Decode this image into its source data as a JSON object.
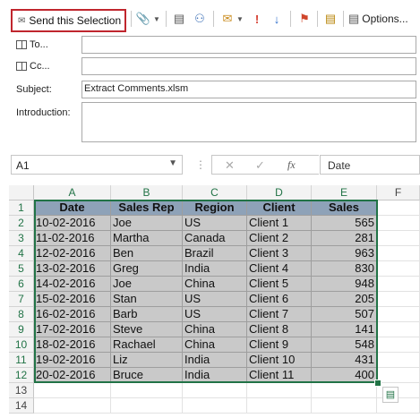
{
  "toolbar": {
    "send_selection_label": "Send this Selection",
    "options_label": "Options..."
  },
  "email": {
    "to_label": "To...",
    "cc_label": "Cc...",
    "subject_label": "Subject:",
    "subject_value": "Extract Comments.xlsm",
    "introduction_label": "Introduction:"
  },
  "formula_bar": {
    "name_box": "A1",
    "formula_value": "Date",
    "fx_label": "fx"
  },
  "sheet": {
    "columns": [
      "A",
      "B",
      "C",
      "D",
      "E",
      "F"
    ],
    "row_numbers": [
      "1",
      "2",
      "3",
      "4",
      "5",
      "6",
      "7",
      "8",
      "9",
      "10",
      "11",
      "12",
      "13",
      "14"
    ],
    "headers": [
      "Date",
      "Sales Rep",
      "Region",
      "Client",
      "Sales"
    ],
    "rows": [
      [
        "10-02-2016",
        "Joe",
        "US",
        "Client 1",
        "565"
      ],
      [
        "11-02-2016",
        "Martha",
        "Canada",
        "Client 2",
        "281"
      ],
      [
        "12-02-2016",
        "Ben",
        "Brazil",
        "Client 3",
        "963"
      ],
      [
        "13-02-2016",
        "Greg",
        "India",
        "Client 4",
        "830"
      ],
      [
        "14-02-2016",
        "Joe",
        "China",
        "Client 5",
        "948"
      ],
      [
        "15-02-2016",
        "Stan",
        "US",
        "Client 6",
        "205"
      ],
      [
        "16-02-2016",
        "Barb",
        "US",
        "Client 7",
        "507"
      ],
      [
        "17-02-2016",
        "Steve",
        "China",
        "Client 8",
        "141"
      ],
      [
        "18-02-2016",
        "Rachael",
        "China",
        "Client 9",
        "548"
      ],
      [
        "19-02-2016",
        "Liz",
        "India",
        "Client 10",
        "431"
      ],
      [
        "20-02-2016",
        "Bruce",
        "India",
        "Client 11",
        "400"
      ]
    ]
  },
  "colors": {
    "highlight_border": "#c0262e",
    "excel_green": "#217346",
    "header_fill": "#8ea2b8",
    "data_fill": "#c9c9c9"
  }
}
